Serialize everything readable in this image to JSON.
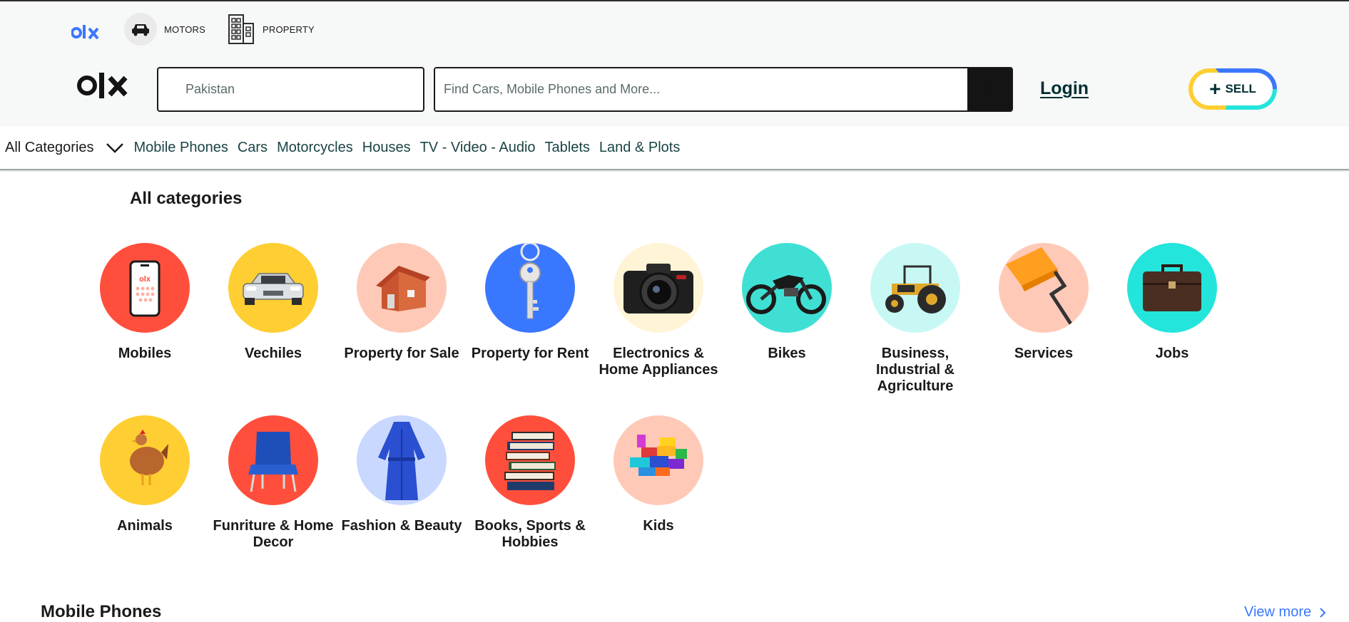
{
  "brands": {
    "motors_label": "MOTORS",
    "property_label": "PROPERTY"
  },
  "header": {
    "location_placeholder": "Pakistan",
    "search_placeholder": "Find Cars, Mobile Phones and More...",
    "login_label": "Login",
    "sell_label": "SELL"
  },
  "nav": {
    "all_categories": "All Categories",
    "links": [
      "Mobile Phones",
      "Cars",
      "Motorcycles",
      "Houses",
      "TV - Video - Audio",
      "Tablets",
      "Land & Plots"
    ]
  },
  "categories_section": {
    "title": "All categories",
    "items": [
      {
        "label": "Mobiles",
        "icon": "mobile-phone-icon",
        "bg": "#ff4f3c"
      },
      {
        "label": "Vechiles",
        "icon": "car-icon",
        "bg": "#ffce32"
      },
      {
        "label": "Property for Sale",
        "icon": "house-icon",
        "bg": "#ffc9b8"
      },
      {
        "label": "Property for Rent",
        "icon": "key-icon",
        "bg": "#3a77ff"
      },
      {
        "label": "Electronics & Home Appliances",
        "icon": "camera-icon",
        "bg": "#fff4d6"
      },
      {
        "label": "Bikes",
        "icon": "motorbike-icon",
        "bg": "#3fe0d3"
      },
      {
        "label": "Business, Industrial & Agriculture",
        "icon": "tractor-icon",
        "bg": "#c8f8f4"
      },
      {
        "label": "Services",
        "icon": "paint-roller-icon",
        "bg": "#ffc9b8"
      },
      {
        "label": "Jobs",
        "icon": "briefcase-icon",
        "bg": "#23e5db"
      },
      {
        "label": "Animals",
        "icon": "chicken-icon",
        "bg": "#ffce32"
      },
      {
        "label": "Funriture & Home Decor",
        "icon": "chair-icon",
        "bg": "#ff4f3c"
      },
      {
        "label": "Fashion & Beauty",
        "icon": "dress-icon",
        "bg": "#c9d8ff"
      },
      {
        "label": "Books, Sports & Hobbies",
        "icon": "books-icon",
        "bg": "#ff4f3c"
      },
      {
        "label": "Kids",
        "icon": "toy-blocks-icon",
        "bg": "#ffc9b8"
      }
    ]
  },
  "mobile_section": {
    "title": "Mobile Phones",
    "view_more": "View more"
  },
  "colors": {
    "brand_blue": "#3a77ff",
    "brand_dark": "#002f34",
    "sell_yellow": "#ffce32",
    "sell_teal": "#23e5db"
  }
}
